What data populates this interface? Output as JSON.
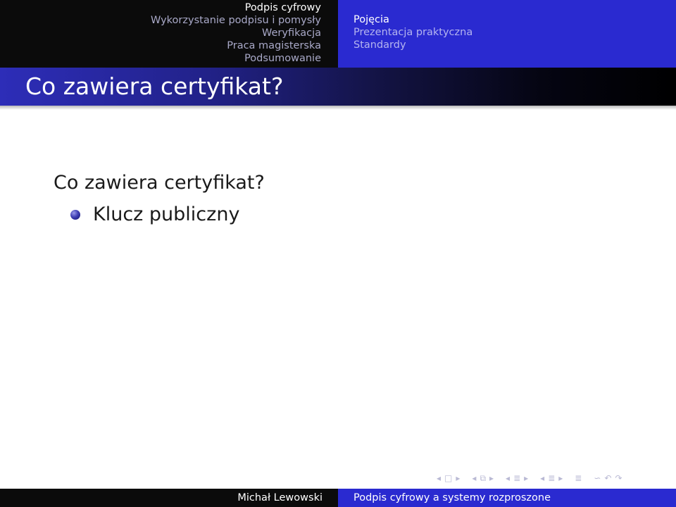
{
  "header": {
    "nav_left": [
      {
        "label": "Podpis cyfrowy",
        "active": true
      },
      {
        "label": "Wykorzystanie podpisu i pomysły",
        "active": false
      },
      {
        "label": "Weryfikacja",
        "active": false
      },
      {
        "label": "Praca magisterska",
        "active": false
      },
      {
        "label": "Podsumowanie",
        "active": false
      }
    ],
    "nav_right": [
      {
        "label": "Pojęcia",
        "active": true
      },
      {
        "label": "Prezentacja praktyczna",
        "active": false
      },
      {
        "label": "Standardy",
        "active": false
      }
    ]
  },
  "frame": {
    "title": "Co zawiera certyfikat?"
  },
  "content": {
    "block_title": "Co zawiera certyfikat?",
    "items": [
      "Klucz publiczny"
    ]
  },
  "footer": {
    "author": "Michał Lewowski",
    "talk_title": "Podpis cyfrowy a systemy rozproszone"
  },
  "nav_symbols": {
    "prev_slide": "◂",
    "slide": "□",
    "next_slide": "▸",
    "prev_frame": "◂",
    "frame": "⧉",
    "next_frame": "▸",
    "prev_subsection": "◂",
    "subsection": "≣",
    "next_subsection": "▸",
    "prev_section": "◂",
    "section": "≣",
    "next_section": "▸",
    "appendix": "≣",
    "search": "∽",
    "back": "↶",
    "forward": "↷"
  },
  "colors": {
    "nav_left_bg": "#0b0b0b",
    "nav_right_bg": "#2a2ad0",
    "title_gradient_start": "#2d2db8",
    "title_gradient_end": "#000000",
    "bullet": "#3a3ab0"
  }
}
